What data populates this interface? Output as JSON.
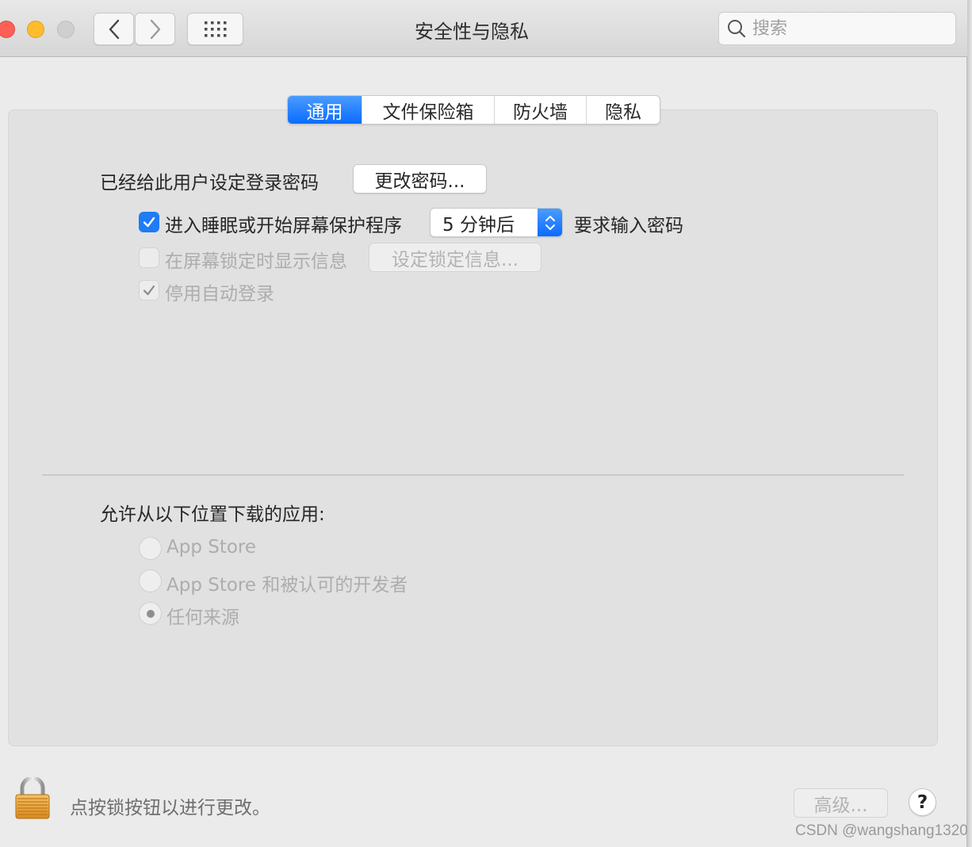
{
  "window": {
    "title": "安全性与隐私",
    "search_placeholder": "搜索",
    "icons": {
      "back": "chevron-left-icon",
      "forward": "chevron-right-icon",
      "grid": "grid-icon",
      "search": "search-icon"
    }
  },
  "tabs": [
    {
      "label": "通用",
      "active": true
    },
    {
      "label": "文件保险箱",
      "active": false
    },
    {
      "label": "防火墙",
      "active": false
    },
    {
      "label": "隐私",
      "active": false
    }
  ],
  "general": {
    "password_set_label": "已经给此用户设定登录密码",
    "change_password_button": "更改密码...",
    "sleep_checkbox": {
      "label": "进入睡眠或开始屏幕保护程序",
      "checked": true,
      "enabled": true
    },
    "delay_select": {
      "value": "5 分钟后"
    },
    "require_password_label": "要求输入密码",
    "lock_message_checkbox": {
      "label": "在屏幕锁定时显示信息",
      "checked": false,
      "enabled": false
    },
    "set_lock_message_button": "设定锁定信息...",
    "disable_autologin_checkbox": {
      "label": "停用自动登录",
      "checked": true,
      "enabled": false
    }
  },
  "downloads": {
    "heading": "允许从以下位置下载的应用:",
    "options": [
      {
        "label": "App Store",
        "selected": false
      },
      {
        "label": "App Store 和被认可的开发者",
        "selected": false
      },
      {
        "label": "任何来源",
        "selected": true
      }
    ]
  },
  "footer": {
    "lock_message": "点按锁按钮以进行更改。",
    "advanced_button": "高级...",
    "help_button": "?",
    "watermark": "CSDN @wangshang1320"
  },
  "colors": {
    "accent": "#0a6cff",
    "close": "#fe5f57",
    "minimize": "#febc2e"
  }
}
